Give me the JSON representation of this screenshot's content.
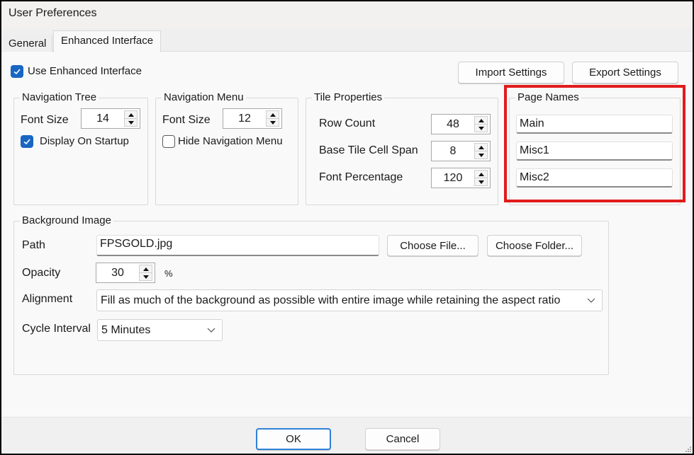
{
  "window": {
    "title": "User Preferences"
  },
  "tabs": [
    {
      "label": "General",
      "active": false
    },
    {
      "label": "Enhanced Interface",
      "active": true
    }
  ],
  "use_enhanced": {
    "label": "Use Enhanced Interface",
    "checked": true
  },
  "toolbar": {
    "import_label": "Import Settings",
    "export_label": "Export Settings"
  },
  "navigation_tree": {
    "title": "Navigation Tree",
    "font_size_label": "Font Size",
    "font_size": "14",
    "display_on_startup": {
      "label": "Display On Startup",
      "checked": true
    }
  },
  "navigation_menu": {
    "title": "Navigation Menu",
    "font_size_label": "Font Size",
    "font_size": "12",
    "hide_menu": {
      "label": "Hide Navigation Menu",
      "checked": false
    }
  },
  "tile_properties": {
    "title": "Tile Properties",
    "fields": [
      {
        "label": "Row Count",
        "value": "48"
      },
      {
        "label": "Base Tile Cell Span",
        "value": "8"
      },
      {
        "label": "Font Percentage",
        "value": "120"
      }
    ]
  },
  "page_names": {
    "title": "Page Names",
    "values": [
      "Main",
      "Misc1",
      "Misc2"
    ],
    "highlight_color": "#e21b1b"
  },
  "background_image": {
    "title": "Background Image",
    "path_label": "Path",
    "path_value": "FPSGOLD.jpg",
    "choose_file_label": "Choose File...",
    "choose_folder_label": "Choose Folder...",
    "opacity_label": "Opacity",
    "opacity_value": "30",
    "opacity_unit": "%",
    "alignment_label": "Alignment",
    "alignment_value": "Fill as much of the background as possible with entire image while retaining the aspect ratio",
    "cycle_label": "Cycle Interval",
    "cycle_value": "5 Minutes"
  },
  "footer": {
    "ok_label": "OK",
    "cancel_label": "Cancel"
  },
  "colors": {
    "accent": "#1966c2",
    "primary_button_border": "#2f82d6"
  }
}
